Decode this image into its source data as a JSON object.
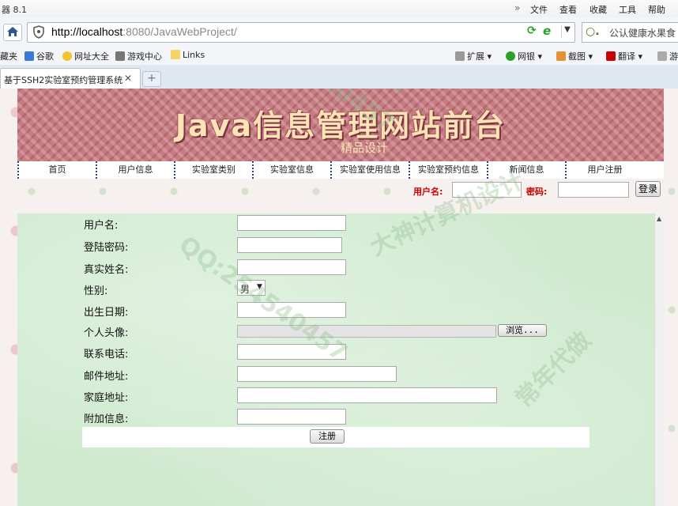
{
  "browser": {
    "title": "器 8.1",
    "chevron": "»",
    "menu": [
      "文件",
      "查看",
      "收藏",
      "工具",
      "帮助"
    ],
    "url_host": "http://localhost",
    "url_rest": ":8080/JavaWebProject/",
    "search_text": "公认健康水果食",
    "bookmarks": [
      "藏夹",
      "谷歌",
      "网址大全",
      "游戏中心",
      "Links"
    ],
    "toolbar_right": [
      "扩展",
      "网银",
      "截图",
      "翻译",
      "游"
    ],
    "tab_title": "基于SSH2实验室预约管理系统",
    "tab_close": "✕",
    "new_tab": "+"
  },
  "site": {
    "banner_title": "Java信息管理网站前台",
    "banner_subtitle": "精品设计",
    "nav": [
      "首页",
      "用户信息",
      "实验室类别",
      "实验室信息",
      "实验室使用信息",
      "实验室预约信息",
      "新闻信息",
      "用户注册"
    ],
    "login": {
      "user_label": "用户名:",
      "pass_label": "密码:",
      "button": "登录"
    }
  },
  "form": {
    "labels": [
      "用户名:",
      "登陆密码:",
      "真实姓名:",
      "性别:",
      "出生日期:",
      "个人头像:",
      "联系电话:",
      "邮件地址:",
      "家庭地址:",
      "附加信息:"
    ],
    "gender_value": "男",
    "browse_button": "浏览...",
    "submit_button": "注册"
  },
  "watermark": [
    "QQ:254540457",
    "大神计算机设计",
    "精品源码",
    "常年代做",
    "QQ:254540457"
  ]
}
